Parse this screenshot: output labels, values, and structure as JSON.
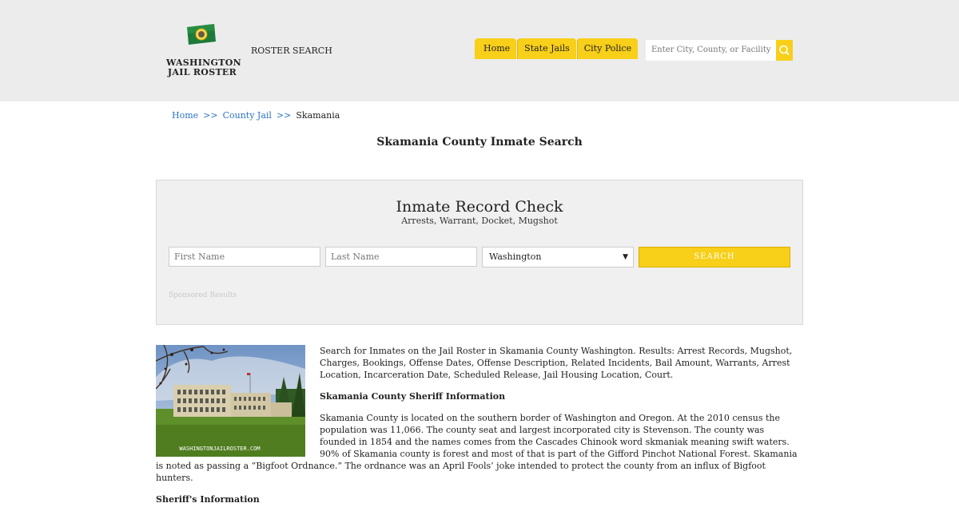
{
  "header": {
    "logo_line1": "WASHINGTON",
    "logo_line2": "JAIL ROSTER",
    "roster_search": "ROSTER SEARCH",
    "nav": [
      "Home",
      "State Jails",
      "City Police"
    ],
    "search_placeholder": "Enter City, County, or Facility",
    "accent_color": "#f8cf19"
  },
  "breadcrumb": {
    "items": [
      "Home",
      "County Jail",
      "Skamania"
    ],
    "separator": ">>"
  },
  "page_title": "Skamania County Inmate Search",
  "panel": {
    "title": "Inmate Record Check",
    "subtitle": "Arrests, Warrant, Docket, Mugshot",
    "first_name_placeholder": "First Name",
    "last_name_placeholder": "Last Name",
    "state_value": "Washington",
    "search_label": "SEARCH",
    "sponsored": "Sponsored Results"
  },
  "photo": {
    "watermark": "WASHINGTONJAILROSTER.COM"
  },
  "content": {
    "intro": "Search for Inmates on the Jail Roster in Skamania County Washington. Results: Arrest Records, Mugshot, Charges, Bookings, Offense Dates, Offense Description, Related Incidents, Bail Amount, Warrants, Arrest Location, Incarceration Date, Scheduled Release, Jail Housing Location, Court.",
    "sheriff_heading": "Skamania County Sheriff Information",
    "description": "Skamania County is located on the southern border of Washington and Oregon. At the 2010 census the population was 11,066. The county seat and largest incorporated city is Stevenson. The county was founded in 1854 and the names comes from the Cascades Chinook word skmaniak meaning swift waters. 90% of Skamania county is forest and most of that is part of the Gifford Pinchot National Forest. Skamania is noted as passing a “Bigfoot Ordnance.” The ordnance was an April Fools’ joke intended to protect the county from an influx of Bigfoot hunters.",
    "sheriffs_info_heading": "Sheriff's Information"
  }
}
